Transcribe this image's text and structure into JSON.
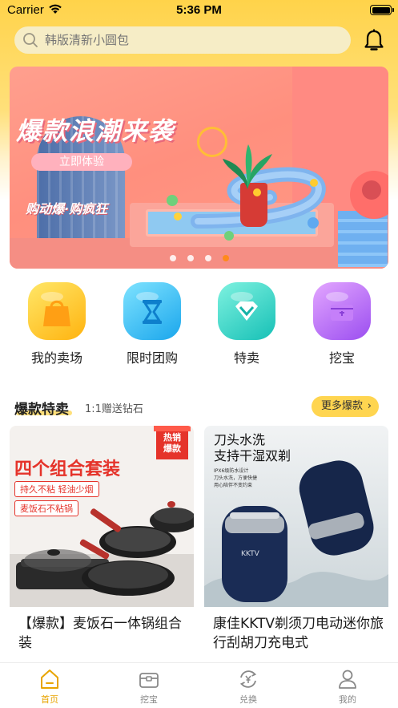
{
  "status_bar": {
    "carrier": "Carrier",
    "time": "5:36 PM"
  },
  "search": {
    "placeholder": "韩版清新小圆包"
  },
  "banner": {
    "title": "爆款浪潮来袭",
    "button_label": "立即体验",
    "subtitle": "购动爆·购疯狂",
    "page_count": 4,
    "active_page": 4
  },
  "categories": [
    {
      "label": "我的卖场",
      "icon": "shopping-bag-icon",
      "color": "#ffc21f"
    },
    {
      "label": "限时团购",
      "icon": "hourglass-icon",
      "color": "#2eb8f0"
    },
    {
      "label": "特卖",
      "icon": "diamond-icon",
      "color": "#22cfc2"
    },
    {
      "label": "挖宝",
      "icon": "treasure-chest-icon",
      "color": "#b565f5"
    }
  ],
  "section": {
    "title": "爆款特卖",
    "subtitle": "1:1赠送钻石",
    "more_label": "更多爆款"
  },
  "products": [
    {
      "title": "【爆款】麦饭石一体锅组合装",
      "image_text": {
        "headline": "四个组合套装",
        "tag1": "持久不粘 轻油少烟",
        "tag2": "麦饭石不粘锅",
        "badge": "热销爆款"
      }
    },
    {
      "title": "康佳KKTV剃须刀电动迷你旅行刮胡刀充电式",
      "image_text": {
        "headline1": "刀头水洗",
        "headline2": "支持干湿双剃",
        "small1": "IPX6级防水设计",
        "small2": "刀头水洗，方便快捷",
        "small3": "用心陪伴不变约束",
        "brand": "KKTV"
      }
    }
  ],
  "tabs": [
    {
      "label": "首页",
      "icon": "home-icon",
      "active": true
    },
    {
      "label": "挖宝",
      "icon": "treasure-chest-icon",
      "active": false
    },
    {
      "label": "兑换",
      "icon": "exchange-icon",
      "active": false
    },
    {
      "label": "我的",
      "icon": "user-icon",
      "active": false
    }
  ],
  "colors": {
    "accent": "#ffd34a",
    "active_tab": "#e8a400",
    "dot_active": "#ff8a1c"
  }
}
